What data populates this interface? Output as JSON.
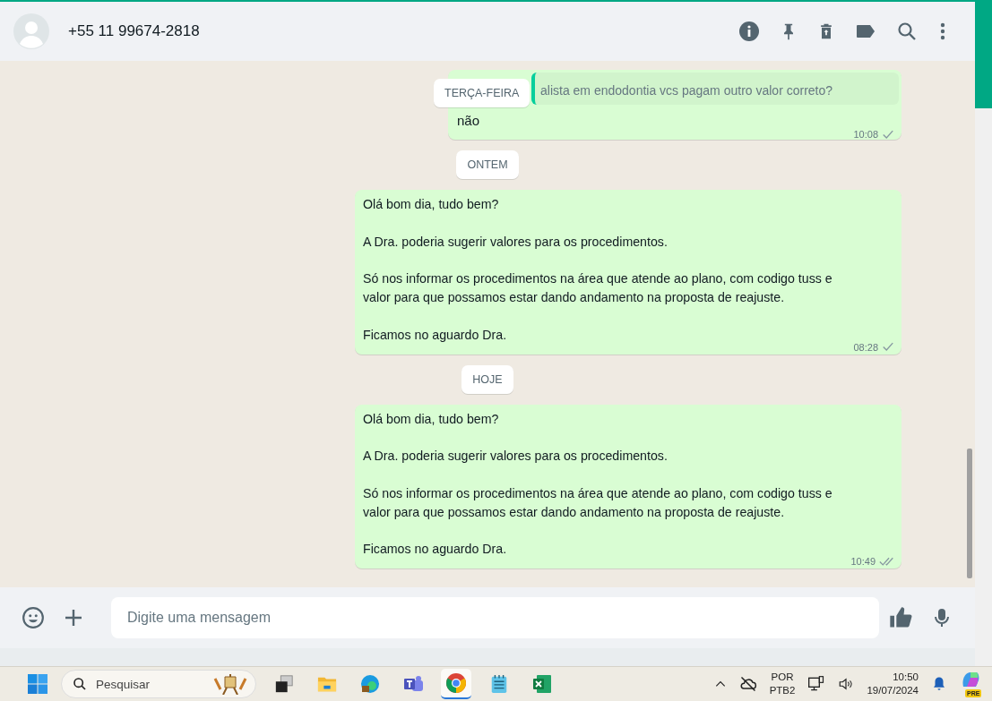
{
  "header": {
    "contact": "+55 11 99674-2818"
  },
  "messages": [
    {
      "kind": "message",
      "quote": "alista em endodontia vcs pagam outro valor correto?",
      "text": "não",
      "time": "10:08",
      "double_check": false,
      "sticky_date": "TERÇA-FEIRA"
    },
    {
      "kind": "date",
      "label": "ONTEM"
    },
    {
      "kind": "message",
      "text": "Olá bom dia, tudo bem?\n\nA Dra. poderia sugerir valores para os procedimentos.\n\nSó nos informar os procedimentos na área que atende ao plano, com codigo tuss e valor para que possamos estar dando andamento na proposta de reajuste.\n\nFicamos no aguardo Dra.",
      "time": "08:28",
      "double_check": false
    },
    {
      "kind": "date",
      "label": "HOJE"
    },
    {
      "kind": "message",
      "text": "Olá bom dia, tudo bem?\n\nA Dra. poderia sugerir valores para os procedimentos.\n\nSó nos informar os procedimentos na área que atende ao plano, com codigo tuss e valor para que possamos estar dando andamento na proposta de reajuste.\n\nFicamos no aguardo Dra.",
      "time": "10:49",
      "double_check": true
    }
  ],
  "composer": {
    "placeholder": "Digite uma mensagem"
  },
  "taskbar": {
    "search_placeholder": "Pesquisar",
    "apps": [
      {
        "kind": "task-view",
        "selected": false
      },
      {
        "kind": "folder",
        "selected": false
      },
      {
        "kind": "edge",
        "selected": false
      },
      {
        "kind": "teams",
        "selected": false
      },
      {
        "kind": "chrome",
        "selected": true
      },
      {
        "kind": "notepad",
        "selected": false
      },
      {
        "kind": "excel",
        "selected": false
      }
    ],
    "language": "POR",
    "layout": "PTB2",
    "time": "10:50",
    "date": "19/07/2024",
    "copilot_badge": "PRE"
  }
}
